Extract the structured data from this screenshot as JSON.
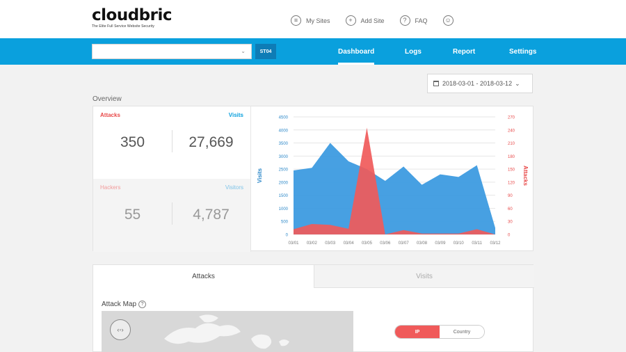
{
  "header": {
    "logo_text": "cloudbric",
    "tagline": "The Elite Full Service Website Security",
    "nav": [
      {
        "label": "My Sites",
        "icon": "list-icon"
      },
      {
        "label": "Add Site",
        "icon": "plus-icon"
      },
      {
        "label": "FAQ",
        "icon": "question-icon"
      },
      {
        "label": "",
        "icon": "user-icon"
      }
    ]
  },
  "navbar": {
    "site_button": "ST04",
    "items": [
      {
        "label": "Dashboard",
        "active": true
      },
      {
        "label": "Logs",
        "active": false
      },
      {
        "label": "Report",
        "active": false
      },
      {
        "label": "Settings",
        "active": false
      }
    ]
  },
  "date_range": "2018-03-01 - 2018-03-12",
  "overview": {
    "title": "Overview",
    "attacks_label": "Attacks",
    "visits_label": "Visits",
    "attacks_value": "350",
    "visits_value": "27,669",
    "hackers_label": "Hackers",
    "visitors_label": "Visitors",
    "hackers_value": "55",
    "visitors_value": "4,787"
  },
  "chart_data": {
    "type": "area",
    "x": [
      "03/01",
      "03/02",
      "03/03",
      "03/04",
      "03/05",
      "03/06",
      "03/07",
      "03/08",
      "03/09",
      "03/10",
      "03/11",
      "03/12"
    ],
    "series": [
      {
        "name": "Visits",
        "axis": "left",
        "color": "#3d9be0",
        "values": [
          2450,
          2550,
          3500,
          2800,
          2500,
          2050,
          2600,
          1900,
          2300,
          2200,
          2650,
          250
        ]
      },
      {
        "name": "Attacks",
        "axis": "right",
        "color": "#f05a5a",
        "values": [
          12,
          24,
          22,
          13,
          245,
          0,
          10,
          2,
          2,
          2,
          12,
          0
        ]
      }
    ],
    "ylabel": "Visits",
    "y2label": "Attacks",
    "ylim": [
      0,
      4500
    ],
    "y2lim": [
      0,
      270
    ],
    "yticks": [
      "0",
      "500",
      "1000",
      "1500",
      "2000",
      "2500",
      "3000",
      "3500",
      "4000",
      "4500"
    ],
    "y2ticks": [
      "0",
      "30",
      "60",
      "90",
      "120",
      "150",
      "180",
      "210",
      "240",
      "270"
    ],
    "grid": true
  },
  "tabs": [
    "Attacks",
    "Visits"
  ],
  "attack_map": {
    "title": "Attack Map",
    "toggle": [
      "IP",
      "Country"
    ]
  },
  "colors": {
    "brand_blue": "#0aa0dd",
    "attack_red": "#f05a5a",
    "visits_blue": "#3d9be0"
  }
}
